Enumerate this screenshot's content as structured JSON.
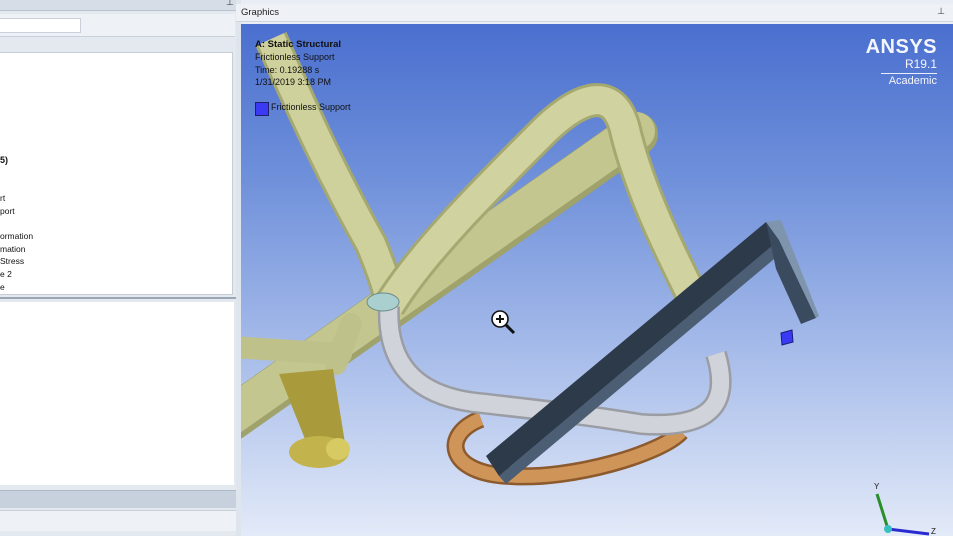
{
  "outline": {
    "items": [
      {
        "label": "5)",
        "bold": true
      },
      {
        "label": "rt",
        "bold": false
      },
      {
        "label": "port",
        "bold": false
      },
      {
        "label": "ormation",
        "bold": false
      },
      {
        "label": "mation",
        "bold": false
      },
      {
        "label": "Stress",
        "bold": false
      },
      {
        "label": "e 2",
        "bold": false
      },
      {
        "label": "e",
        "bold": false
      }
    ]
  },
  "graphics": {
    "panel_title": "Graphics",
    "pin_icon": "pin-icon",
    "analysis_title": "A: Static Structural",
    "object_name": "Frictionless Support",
    "time": "Time: 0.19288 s",
    "date": "1/31/2019 3:18 PM",
    "legend": {
      "label": "Frictionless Support",
      "color": "#3a3af5"
    },
    "brand": {
      "name": "ANSYS",
      "version": "R19.1",
      "tier": "Academic"
    },
    "triad": {
      "y": "Y",
      "z": "Z"
    }
  },
  "colors": {
    "background_top": "#4a6fcf",
    "background_bottom": "#e3eaf8",
    "pipe": "#c9cb96",
    "rod": "#c3c6cc",
    "beam": "#2e3b4c",
    "copper": "#c98a4e",
    "support": "#3a3af5"
  }
}
